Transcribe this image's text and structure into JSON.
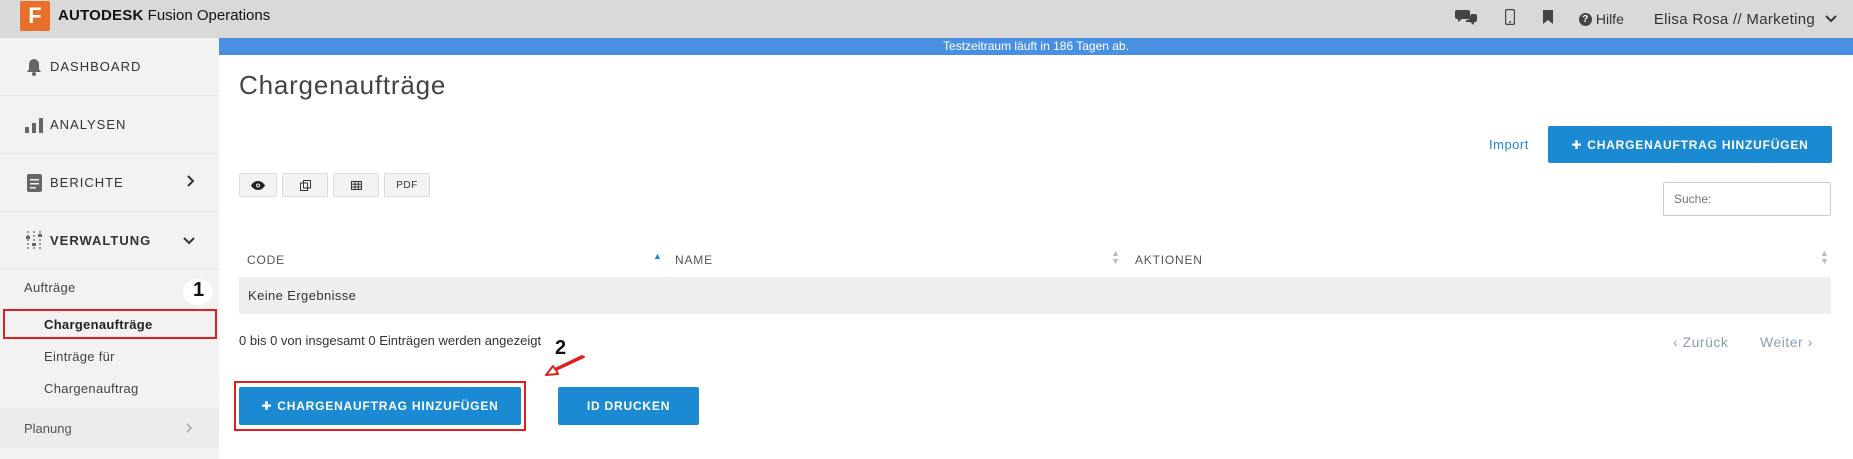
{
  "topbar": {
    "logo_letter": "F",
    "brand_bold": "AUTODESK",
    "brand_rest": " Fusion Operations",
    "help_label": "Hilfe",
    "user_label": "Elisa Rosa // Marketing"
  },
  "banner": {
    "text": "Testzeitraum läuft in 186 Tagen ab."
  },
  "sidebar": {
    "items": [
      {
        "label": "DASHBOARD",
        "icon": "bell-icon"
      },
      {
        "label": "ANALYSEN",
        "icon": "bar-chart-icon"
      },
      {
        "label": "BERICHTE",
        "icon": "document-icon"
      },
      {
        "label": "VERWALTUNG",
        "icon": "sliders-icon"
      }
    ],
    "section_label": "Aufträge",
    "sub_items": [
      "Chargenaufträge",
      "Einträge für",
      "Chargenauftrag"
    ],
    "planung_label": "Planung"
  },
  "main": {
    "title": "Chargenaufträge",
    "import_label": "Import",
    "add_top_label": "CHARGENAUFTRAG HINZUFÜGEN",
    "toolbar": {
      "pdf_label": "PDF"
    },
    "search_placeholder": "Suche:",
    "columns": [
      "CODE",
      "NAME",
      "AKTIONEN"
    ],
    "empty_text": "Keine Ergebnisse",
    "info_text": "0 bis 0 von insgesamt 0 Einträgen werden angezeigt",
    "prev_label": "Zurück",
    "next_label": "Weiter",
    "add_bottom_label": "CHARGENAUFTRAG HINZUFÜGEN",
    "print_label": "ID DRUCKEN"
  },
  "annotations": {
    "step1": "1",
    "step2": "2"
  },
  "colors": {
    "accent": "#1b8ad3",
    "banner": "#4a90e2",
    "annotation": "#e02020",
    "logo": "#e8702a"
  }
}
